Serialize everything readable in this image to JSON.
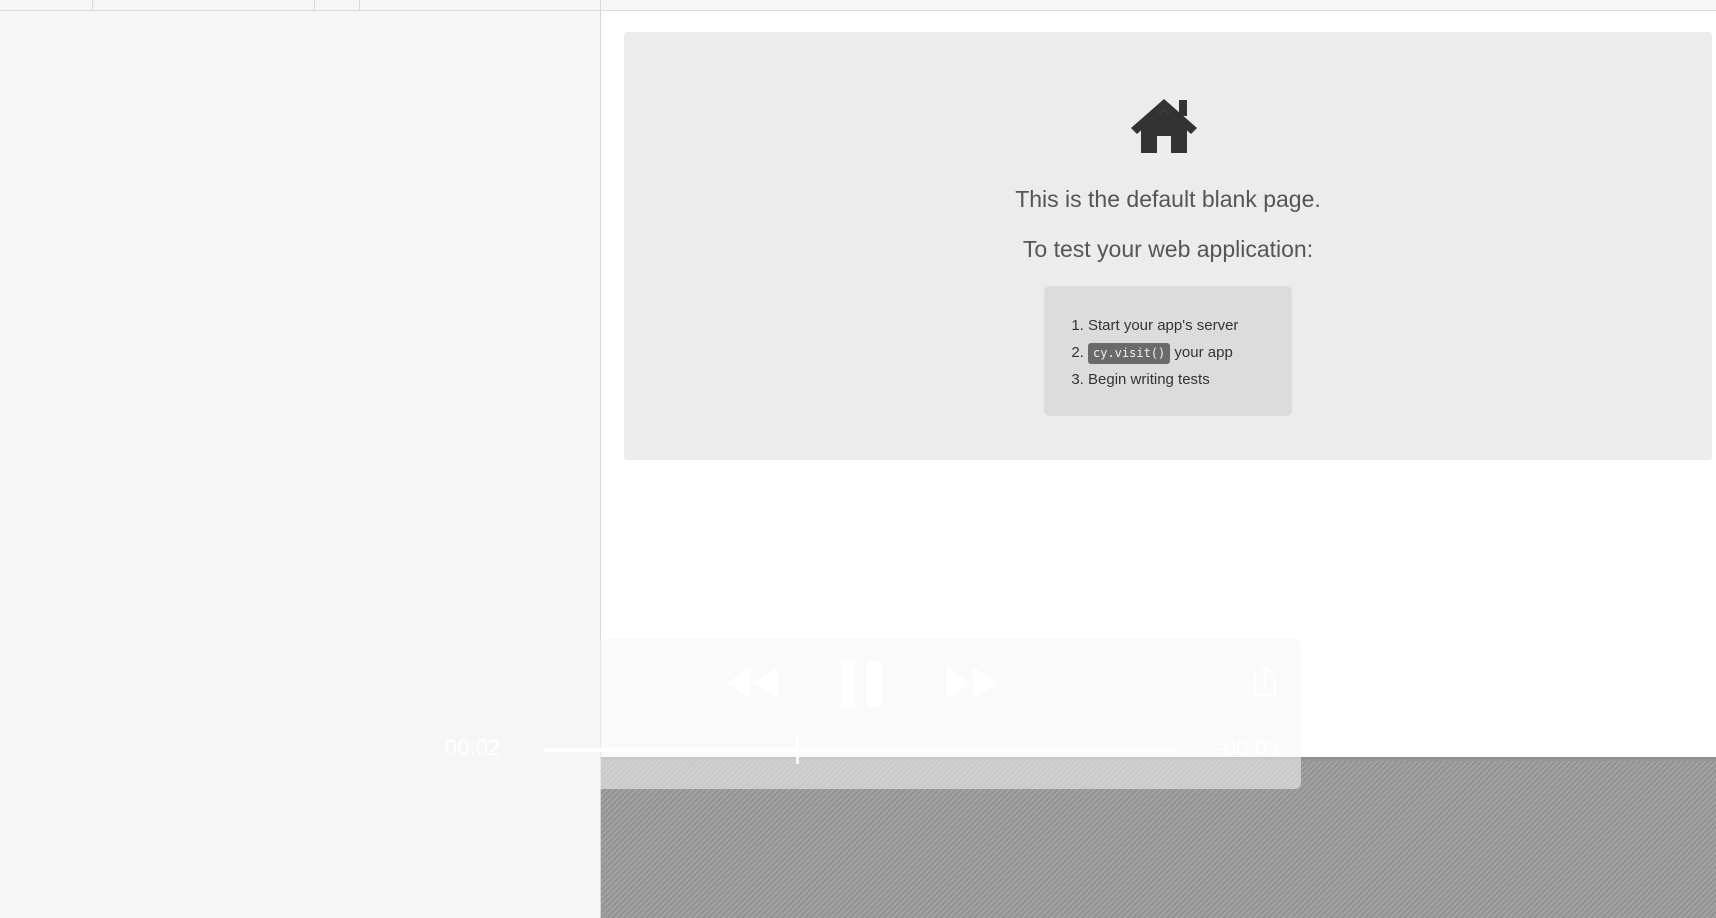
{
  "aut": {
    "home_icon": "home-icon",
    "blank_message": "This is the default blank page.",
    "test_intro": "To test your web application:",
    "steps": {
      "step1": "Start your app's server",
      "step2_code": "cy.visit()",
      "step2_text": " your app",
      "step3": "Begin writing tests"
    }
  },
  "player": {
    "elapsed": "00:02",
    "remaining": "-00:03",
    "progress": 0.4,
    "icons": {
      "rewind": "rewind-icon",
      "pause": "pause-icon",
      "forward": "fast-forward-icon",
      "share": "share-icon"
    }
  },
  "colors": {
    "card_background": "#ececec",
    "steps_background": "#dcdcdc",
    "code_pill": "#6a6a6a"
  }
}
